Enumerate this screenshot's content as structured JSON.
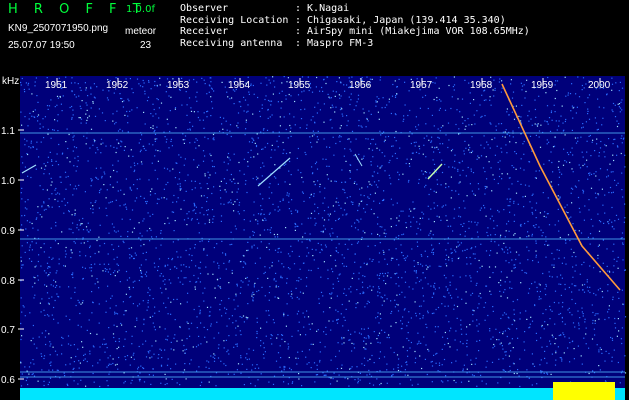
{
  "app": {
    "brand": "H R O F F T",
    "version": "1.0.0f",
    "file_name": "KN9_2507071950.png",
    "timestamp": "25.07.07 19:50",
    "mode_label": "meteor",
    "count": "23"
  },
  "meta": [
    {
      "key": "Observer",
      "value": ": K.Nagai"
    },
    {
      "key": "Receiving Location",
      "value": ": Chigasaki, Japan (139.414 35.340)"
    },
    {
      "key": "Receiver",
      "value": ": AirSpy mini (Miakejima VOR 108.65MHz)"
    },
    {
      "key": "Receiving antenna",
      "value": ": Maspro FM-3"
    }
  ],
  "axis": {
    "unit": "kHz",
    "y_ticks": [
      "1.1",
      "1.0",
      "0.9",
      "0.8",
      "0.7",
      "0.6"
    ],
    "x_ticks": [
      "1951",
      "1952",
      "1953",
      "1954",
      "1955",
      "1956",
      "1957",
      "1958",
      "1959",
      "2000"
    ]
  },
  "colors": {
    "background": "#00007a",
    "noise": "#2a6cff",
    "accent": "#00ff3c",
    "baseline": "#00e5ff",
    "signal": "#ffff00"
  }
}
